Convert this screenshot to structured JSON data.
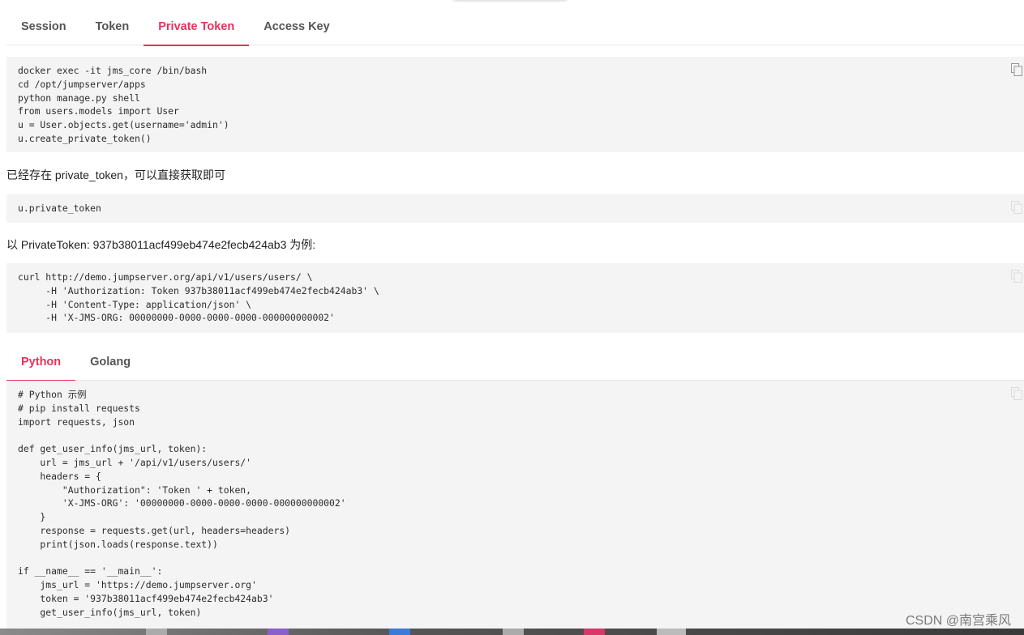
{
  "tabs": [
    {
      "label": "Session",
      "active": false
    },
    {
      "label": "Token",
      "active": false
    },
    {
      "label": "Private Token",
      "active": true
    },
    {
      "label": "Access Key",
      "active": false
    }
  ],
  "code1": [
    "docker exec -it jms_core /bin/bash",
    "cd /opt/jumpserver/apps",
    "python manage.py shell",
    "from users.models import User",
    "u = User.objects.get(username='admin')",
    "u.create_private_token()"
  ],
  "para1": "已经存在 private_token，可以直接获取即可",
  "code2": [
    "u.private_token"
  ],
  "para2": "以 PrivateToken: 937b38011acf499eb474e2fecb424ab3 为例:",
  "code3": [
    "curl http://demo.jumpserver.org/api/v1/users/users/ \\",
    "     -H 'Authorization: Token 937b38011acf499eb474e2fecb424ab3' \\",
    "     -H 'Content-Type: application/json' \\",
    "     -H 'X-JMS-ORG: 00000000-0000-0000-0000-000000000002'"
  ],
  "lang_tabs": [
    {
      "label": "Python",
      "active": true
    },
    {
      "label": "Golang",
      "active": false
    }
  ],
  "code4": [
    "# Python 示例",
    "# pip install requests",
    "import requests, json",
    "",
    "def get_user_info(jms_url, token):",
    "    url = jms_url + '/api/v1/users/users/'",
    "    headers = {",
    "        \"Authorization\": 'Token ' + token,",
    "        'X-JMS-ORG': '00000000-0000-0000-0000-000000000002'",
    "    }",
    "    response = requests.get(url, headers=headers)",
    "    print(json.loads(response.text))",
    "",
    "if __name__ == '__main__':",
    "    jms_url = 'https://demo.jumpserver.org'",
    "    token = '937b38011acf499eb474e2fecb424ab3'",
    "    get_user_info(jms_url, token)"
  ],
  "watermark": "CSDN @南宫乘风",
  "icons": {
    "copy": "copy-icon"
  },
  "colors": {
    "accent": "#e8315b",
    "code_bg": "#f4f4f4",
    "keyword": "#3b6ecf",
    "string": "#1f8a4c"
  }
}
